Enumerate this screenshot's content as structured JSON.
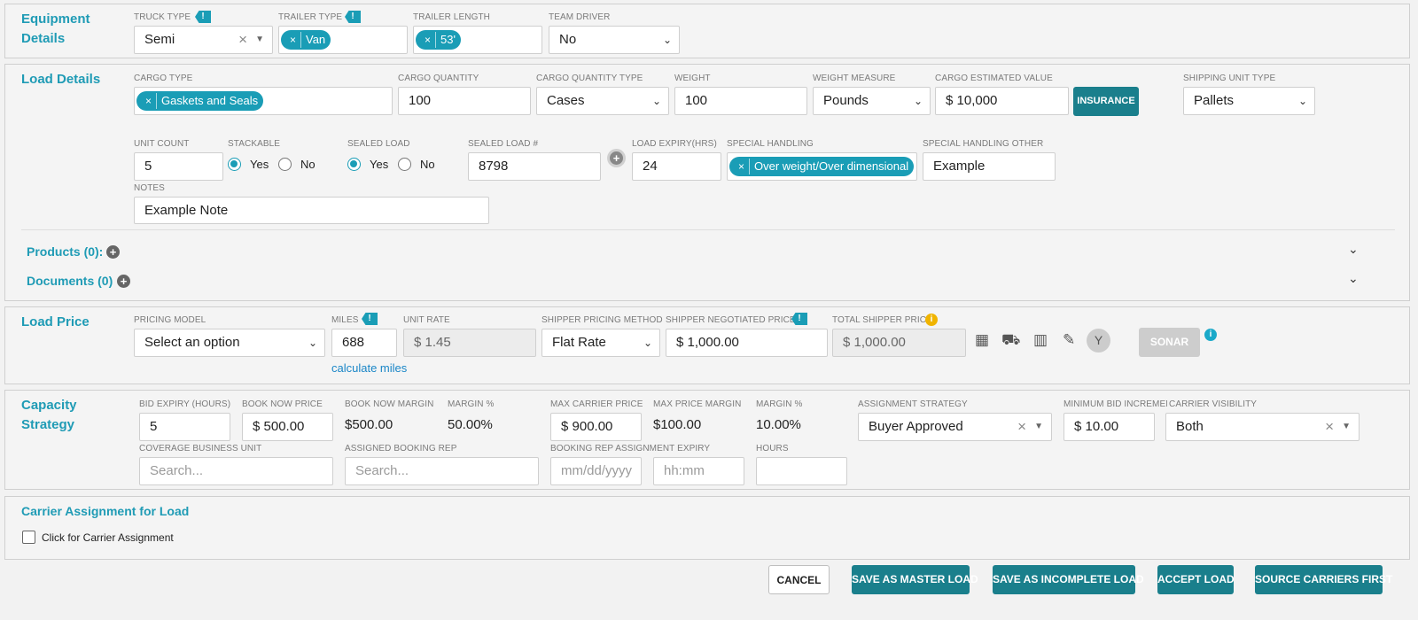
{
  "equipment": {
    "title": "Equipment Details",
    "truck_type": {
      "label": "TRUCK TYPE",
      "value": "Semi"
    },
    "trailer_type": {
      "label": "TRAILER TYPE",
      "chip": "Van"
    },
    "trailer_length": {
      "label": "TRAILER LENGTH",
      "chip": "53'"
    },
    "team_driver": {
      "label": "TEAM DRIVER",
      "value": "No"
    }
  },
  "load_details": {
    "title": "Load Details",
    "cargo_type": {
      "label": "CARGO TYPE",
      "chip": "Gaskets and Seals"
    },
    "cargo_quantity": {
      "label": "CARGO QUANTITY",
      "value": "100"
    },
    "cargo_quantity_type": {
      "label": "CARGO QUANTITY TYPE",
      "value": "Cases"
    },
    "weight": {
      "label": "WEIGHT",
      "value": "100"
    },
    "weight_measure": {
      "label": "WEIGHT MEASURE",
      "value": "Pounds"
    },
    "cargo_value": {
      "label": "CARGO ESTIMATED VALUE",
      "value": "$ 10,000"
    },
    "insurance_button": "INSURANCE",
    "shipping_unit_type": {
      "label": "SHIPPING UNIT TYPE",
      "value": "Pallets"
    },
    "unit_count": {
      "label": "UNIT COUNT",
      "value": "5"
    },
    "stackable": {
      "label": "STACKABLE",
      "yes": "Yes",
      "no": "No",
      "selected": "Yes"
    },
    "sealed_load": {
      "label": "SEALED LOAD",
      "yes": "Yes",
      "no": "No",
      "selected": "Yes"
    },
    "sealed_load_number": {
      "label": "SEALED LOAD #",
      "value": "8798"
    },
    "load_expiry": {
      "label": "LOAD EXPIRY(HRS)",
      "value": "24"
    },
    "special_handling": {
      "label": "SPECIAL HANDLING",
      "chip": "Over weight/Over dimensional"
    },
    "special_handling_other": {
      "label": "SPECIAL HANDLING OTHER",
      "value": "Example"
    },
    "notes": {
      "label": "NOTES",
      "value": "Example Note"
    },
    "products": "Products (0):",
    "documents": "Documents (0)"
  },
  "load_price": {
    "title": "Load Price",
    "pricing_model": {
      "label": "PRICING MODEL",
      "value": "Select an option"
    },
    "miles": {
      "label": "MILES",
      "value": "688",
      "link": "calculate miles"
    },
    "unit_rate": {
      "label": "UNIT RATE",
      "value": "$ 1.45"
    },
    "shipper_pricing_method": {
      "label": "SHIPPER PRICING METHOD",
      "value": "Flat Rate"
    },
    "shipper_negotiated_price": {
      "label": "SHIPPER NEGOTIATED PRICE",
      "value": "$ 1,000.00"
    },
    "total_shipper_price": {
      "label": "TOTAL SHIPPER PRICE",
      "value": "$ 1,000.00"
    },
    "sonar_button": "SONAR",
    "tool_icons": [
      "calculator-icon",
      "truck-dollar-icon",
      "map-icon",
      "document-edit-icon",
      "fork-icon"
    ]
  },
  "capacity": {
    "title": "Capacity Strategy",
    "bid_expiry": {
      "label": "BID EXPIRY (HOURS)",
      "value": "5"
    },
    "book_now_price": {
      "label": "BOOK NOW PRICE",
      "value": "$ 500.00"
    },
    "book_now_margin": {
      "label": "BOOK NOW MARGIN",
      "value": "$500.00"
    },
    "margin_pct_1": {
      "label": "MARGIN %",
      "value": "50.00%"
    },
    "max_carrier_price": {
      "label": "MAX CARRIER PRICE",
      "value": "$ 900.00"
    },
    "max_price_margin": {
      "label": "MAX PRICE MARGIN",
      "value": "$100.00"
    },
    "margin_pct_2": {
      "label": "MARGIN %",
      "value": "10.00%"
    },
    "assignment_strategy": {
      "label": "ASSIGNMENT STRATEGY",
      "value": "Buyer Approved"
    },
    "minimum_bid_increment": {
      "label": "MINIMUM BID INCREMENT",
      "value": "$ 10.00"
    },
    "carrier_visibility": {
      "label": "CARRIER VISIBILITY",
      "value": "Both"
    },
    "coverage_business_unit": {
      "label": "COVERAGE BUSINESS UNIT",
      "placeholder": "Search..."
    },
    "assigned_booking_rep": {
      "label": "ASSIGNED BOOKING REP",
      "placeholder": "Search..."
    },
    "booking_rep_expiry": {
      "label": "BOOKING REP ASSIGNMENT EXPIRY",
      "date_placeholder": "mm/dd/yyyy",
      "time_placeholder": "hh:mm"
    },
    "hours": {
      "label": "HOURS",
      "value": ""
    }
  },
  "carrier_assignment": {
    "title": "Carrier Assignment for Load",
    "checkbox_label": "Click for Carrier Assignment"
  },
  "footer": {
    "cancel": "CANCEL",
    "save_master": "SAVE AS MASTER LOAD",
    "save_incomplete": "SAVE AS INCOMPLETE LOAD",
    "accept": "ACCEPT LOAD",
    "source_carriers": "SOURCE CARRIERS FIRST"
  },
  "colors": {
    "accent": "#1a9db6",
    "button": "#1a7f8c",
    "title": "#1f9bb5",
    "warning": "#f0b400"
  }
}
